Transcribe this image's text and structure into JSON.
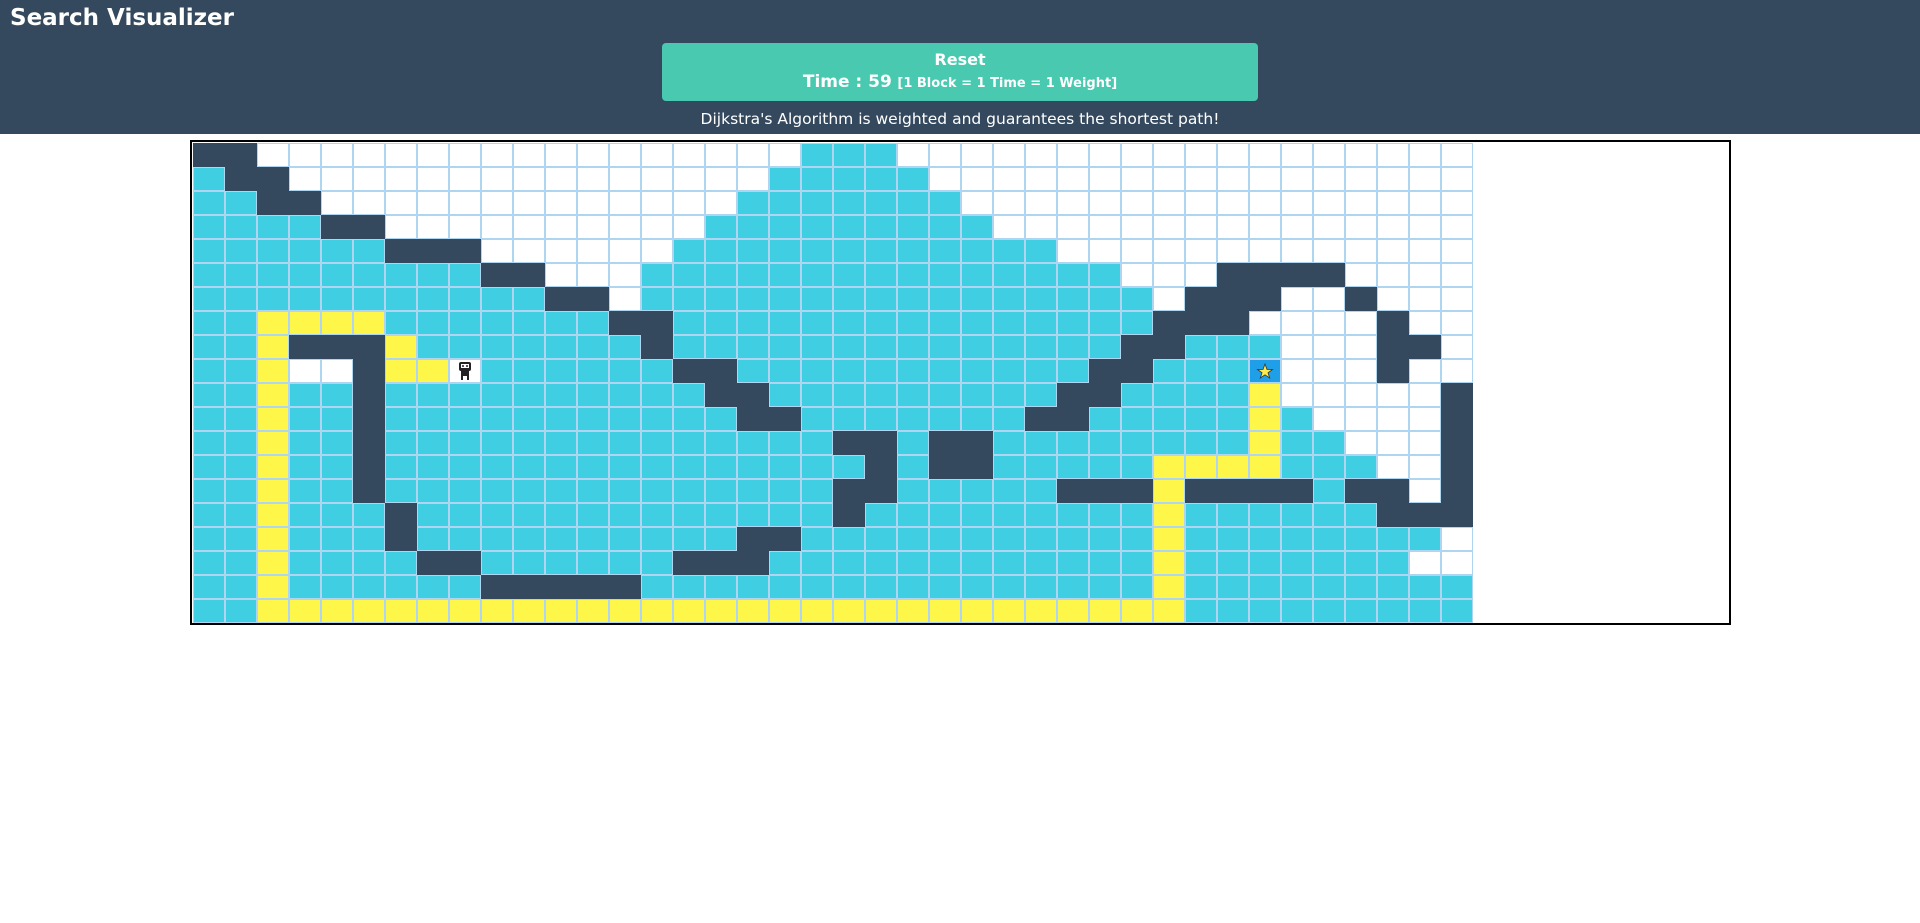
{
  "app": {
    "title": "Search Visualizer"
  },
  "controls": {
    "reset_label": "Reset",
    "time_label": "Time : 59",
    "time_note": "[1 Block = 1 Time = 1 Weight]"
  },
  "description": "Dijkstra's Algorithm is weighted and guarantees the shortest path!",
  "colors": {
    "header": "#34495e",
    "button": "#48c9b0",
    "visited": "#40cee3",
    "wall": "#34495e",
    "path": "#fff64a",
    "unvisited": "#ffffff",
    "grid_line": "#aed6f1",
    "target_bg": "#1f9fe8"
  },
  "grid": {
    "legend": {
      ".": "unvisited",
      "v": "visited",
      "#": "wall",
      "y": "path",
      "S": "start (robot-icon)",
      "T": "target (star-icon)"
    },
    "rows": [
      "##.................vvv..................",
      "v##...............vvvvv.................",
      "vv##.............vvvvvvv................",
      "vvvv##..........vvvvvvvvv...............",
      "vvvvvv###......vvvvvvvvvvvv.............",
      "vvvvvvvvv##...vvvvvvvvvvvvvvv...####....",
      "vvvvvvvvvvv##.vvvvvvvvvvvvvvvv.###..#...",
      "vvyyyyvvvvvvv##vvvvvvvvvvvvvvv###....#..",
      "vvy###yvvvvvvv#vvvvvvvvvvvvvv##vvv...##.",
      "vvy..#yySvvvvvv##vvvvvvvvvvv##vvvT...#..",
      "vvyvv#vvvvvvvvvv##vvvvvvvvv##vvvvy.....#",
      "vvyvv#vvvvvvvvvvv##vvvvvvv##vvvvvyv....#",
      "vvyvv#vvvvvvvvvvvvvv##v##vvvvvvvvyvv...#",
      "vvyvv#vvvvvvvvvvvvvvv#v##vvvvvyyyyvvv..#",
      "vvyvv#vvvvvvvvvvvvvv##vvvvv###y####v##.##",
      "vvyvvv#vvvvvvvvvvvvv#vvvvvvvvvyvvvvvv####",
      "vvyvvv#vvvvvvvvvv##vvvvvvvvvvvyvvvvvvvv.",
      "vvyvvvv##vvvvvv###vvvvvvvvvvvvyvvvvvvv..",
      "vvyvvvvvv#####vvvvvvvvvvvvvvvvyvvvvvvvvv",
      "vvyyyyyyyyyyyyyyyyyyyyyyyyyyyyyvvvvvvvvv"
    ]
  }
}
